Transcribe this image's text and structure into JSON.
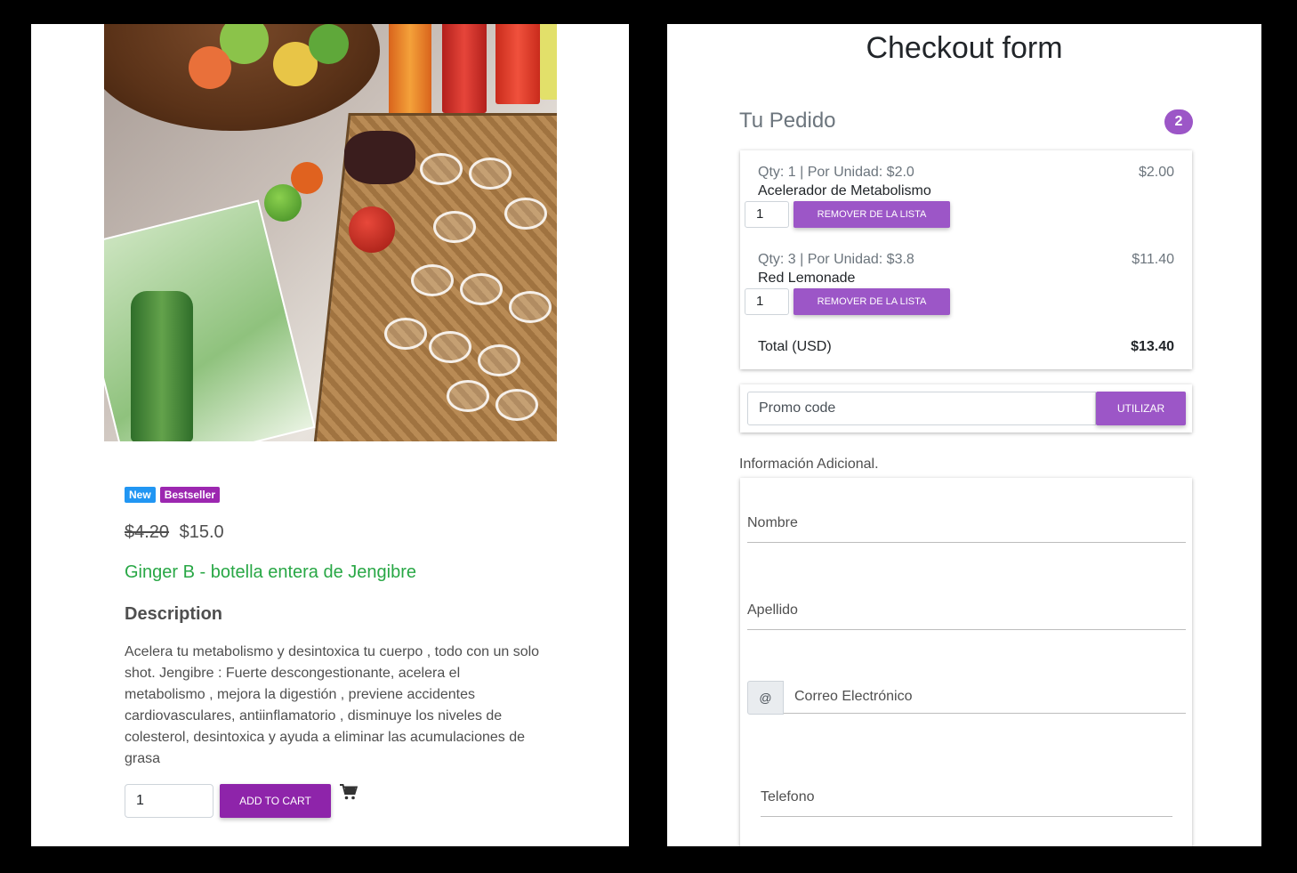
{
  "product": {
    "badges": [
      "New",
      "Bestseller"
    ],
    "old_price": "$4.20",
    "price": "$15.0",
    "title": "Ginger B - botella entera de Jengibre",
    "description_heading": "Description",
    "description": "Acelera tu metabolismo y desintoxica tu cuerpo , todo con un solo shot. Jengibre : Fuerte descongestionante, acelera el metabolismo , mejora la digestión , previene accidentes cardiovasculares, antiinflamatorio , disminuye los niveles de colesterol, desintoxica y ayuda a eliminar las acumulaciones de grasa",
    "quantity": "1",
    "add_to_cart_label": "ADD TO CART",
    "cart_icon": "shopping-cart-icon"
  },
  "checkout": {
    "title": "Checkout form",
    "order_label": "Tu Pedido",
    "item_count": "2",
    "items": [
      {
        "meta": "Qty: 1 | Por Unidad: $2.0",
        "name": "Acelerador de Metabolismo",
        "price": "$2.00",
        "qty": "1",
        "remove_label": "REMOVER DE LA LISTA"
      },
      {
        "meta": "Qty: 3 | Por Unidad: $3.8",
        "name": "Red Lemonade",
        "price": "$11.40",
        "qty": "1",
        "remove_label": "REMOVER DE LA LISTA"
      }
    ],
    "total_label": "Total (USD)",
    "total_value": "$13.40",
    "promo_placeholder": "Promo code",
    "promo_button": "UTILIZAR",
    "info_label": "Información Adicional.",
    "fields": {
      "first_name": "Nombre",
      "last_name": "Apellido",
      "email_prefix": "@",
      "email": "Correo Electrónico",
      "phone": "Telefono"
    }
  },
  "colors": {
    "accent_purple": "#8e24aa",
    "button_purple": "#9c56c7",
    "badge_new": "#2196f3",
    "badge_bestseller": "#9c27b0",
    "title_green": "#28a745"
  }
}
